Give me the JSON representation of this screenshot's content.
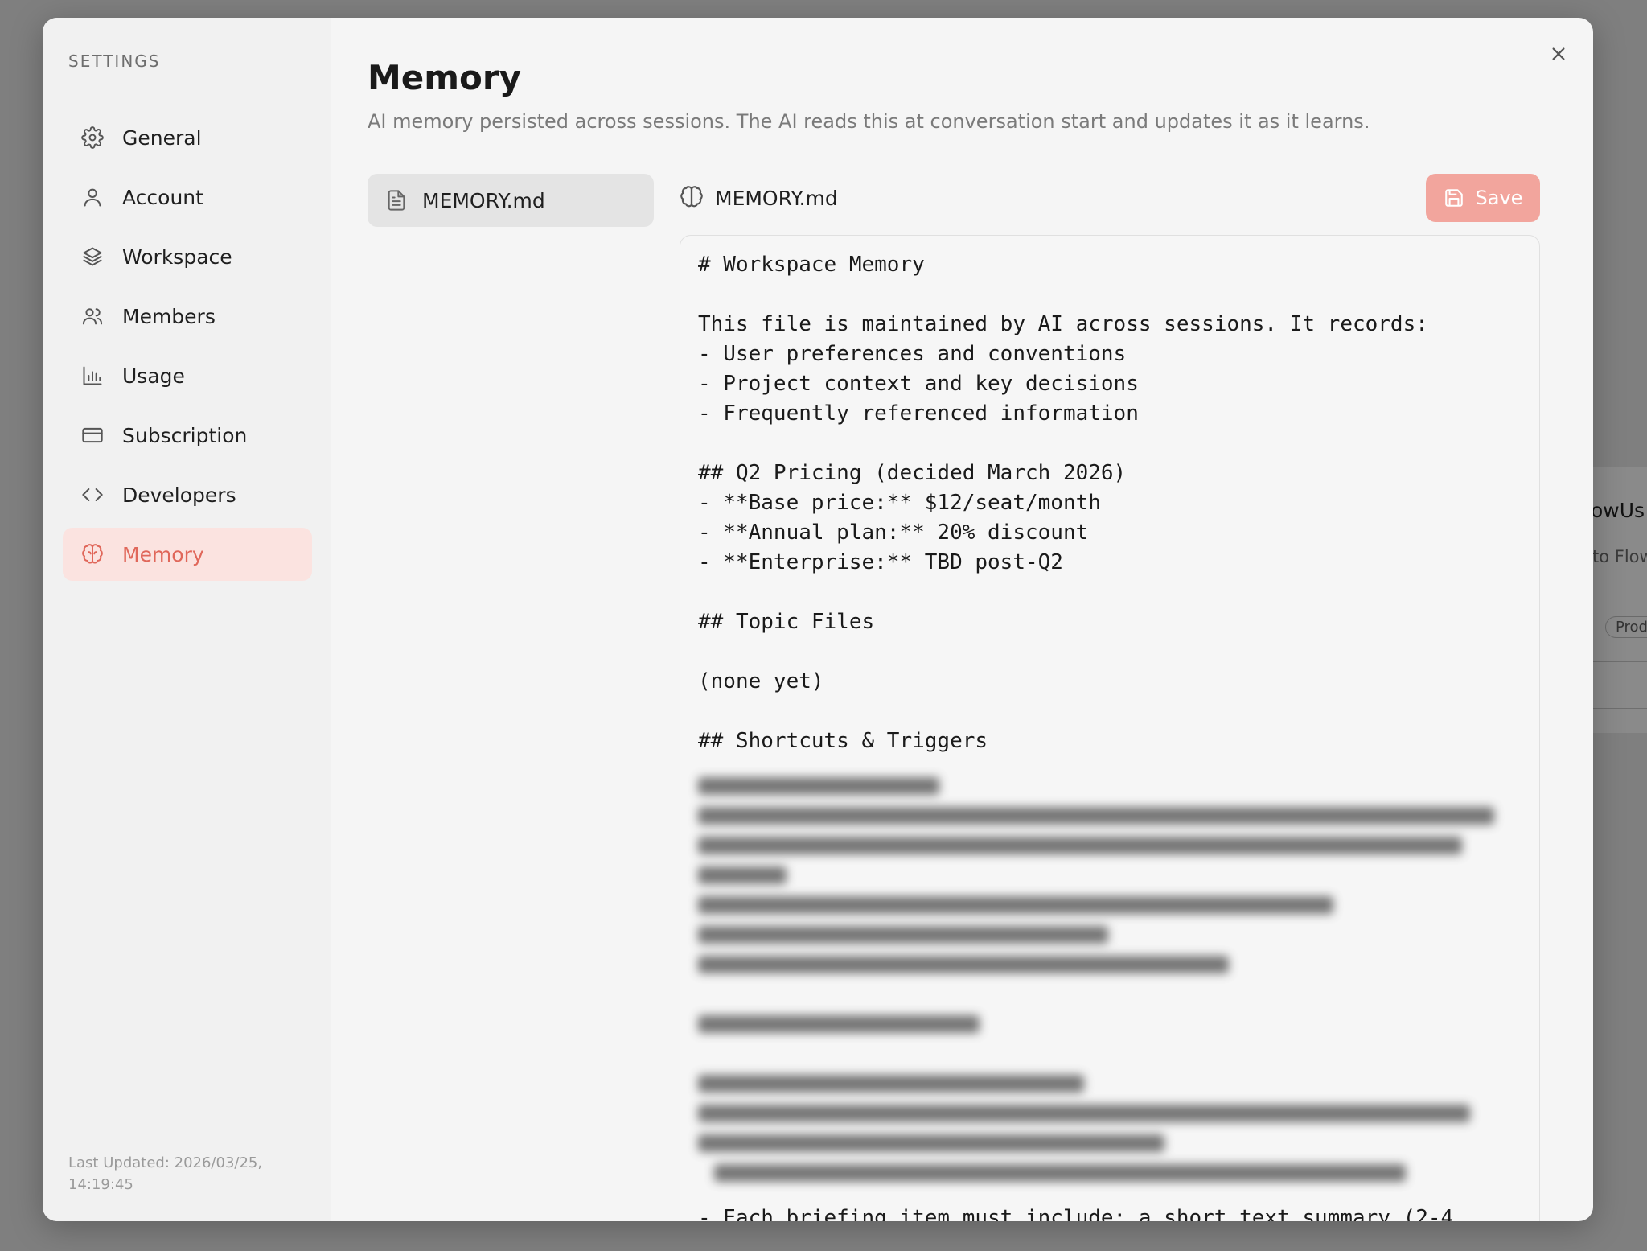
{
  "background": {
    "title": "owUs",
    "subtitle": "to Flow",
    "pill": "Prod"
  },
  "sidebar": {
    "heading": "SETTINGS",
    "items": [
      {
        "label": "General",
        "icon": "gear-icon"
      },
      {
        "label": "Account",
        "icon": "user-icon"
      },
      {
        "label": "Workspace",
        "icon": "layers-icon"
      },
      {
        "label": "Members",
        "icon": "users-icon"
      },
      {
        "label": "Usage",
        "icon": "bar-chart-icon"
      },
      {
        "label": "Subscription",
        "icon": "credit-card-icon"
      },
      {
        "label": "Developers",
        "icon": "code-icon"
      },
      {
        "label": "Memory",
        "icon": "brain-icon",
        "active": true
      }
    ],
    "last_updated": "Last Updated: 2026/03/25, 14:19:45"
  },
  "main": {
    "title": "Memory",
    "description": "AI memory persisted across sessions. The AI reads this at conversation start and updates it as it learns.",
    "files": [
      {
        "label": "MEMORY.md",
        "icon": "file-icon"
      }
    ],
    "editor": {
      "filename": "MEMORY.md",
      "save_label": "Save",
      "content_visible": "# Workspace Memory\n\nThis file is maintained by AI across sessions. It records:\n- User preferences and conventions\n- Project context and key decisions\n- Frequently referenced information\n\n## Q2 Pricing (decided March 2026)\n- **Base price:** $12/seat/month\n- **Annual plan:** 20% discount\n- **Enterprise:** TBD post-Q2\n\n## Topic Files\n\n(none yet)\n\n## Shortcuts & Triggers\n",
      "content_bottom": "- Each briefing item must include: a short text summary (2-4"
    }
  },
  "colors": {
    "accent": "#e0675a",
    "accent_bg": "#fbe3e0",
    "save_bg": "#f2a59d",
    "overlay": "#7f7f7f"
  }
}
